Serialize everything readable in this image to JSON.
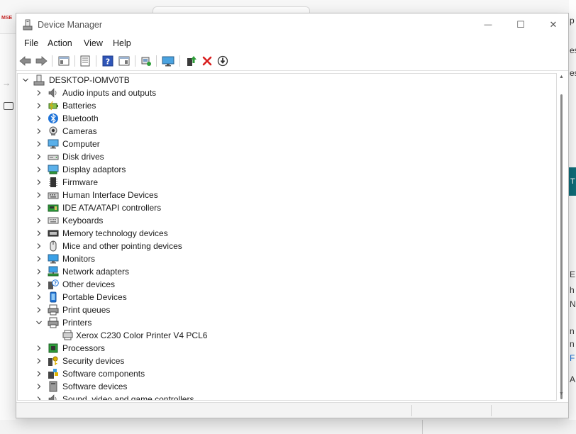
{
  "window": {
    "title": "Device Manager",
    "controls": {
      "minimize": "—",
      "maximize": "☐",
      "close": "✕"
    }
  },
  "menu": [
    "File",
    "Action",
    "View",
    "Help"
  ],
  "toolbar_icons": [
    "back-icon",
    "forward-icon",
    "show-hide-console-tree-icon",
    "properties-sheet-icon",
    "help-icon",
    "action-pane-icon",
    "scan-hardware-changes-icon",
    "monitor-icon",
    "update-driver-icon",
    "uninstall-device-icon",
    "disable-device-icon"
  ],
  "tree": {
    "root": "DESKTOP-IOMV0TB",
    "items": [
      {
        "label": "Audio inputs and outputs",
        "icon": "speaker-icon",
        "expanded": false
      },
      {
        "label": "Batteries",
        "icon": "battery-icon",
        "expanded": false
      },
      {
        "label": "Bluetooth",
        "icon": "bluetooth-icon",
        "expanded": false
      },
      {
        "label": "Cameras",
        "icon": "camera-icon",
        "expanded": false
      },
      {
        "label": "Computer",
        "icon": "computer-icon",
        "expanded": false
      },
      {
        "label": "Disk drives",
        "icon": "disk-drive-icon",
        "expanded": false
      },
      {
        "label": "Display adaptors",
        "icon": "display-adapter-icon",
        "expanded": false
      },
      {
        "label": "Firmware",
        "icon": "firmware-icon",
        "expanded": false
      },
      {
        "label": "Human Interface Devices",
        "icon": "hid-icon",
        "expanded": false
      },
      {
        "label": "IDE ATA/ATAPI controllers",
        "icon": "ide-controller-icon",
        "expanded": false
      },
      {
        "label": "Keyboards",
        "icon": "keyboard-icon",
        "expanded": false
      },
      {
        "label": "Memory technology devices",
        "icon": "memory-icon",
        "expanded": false
      },
      {
        "label": "Mice and other pointing devices",
        "icon": "mouse-icon",
        "expanded": false
      },
      {
        "label": "Monitors",
        "icon": "monitor-icon",
        "expanded": false
      },
      {
        "label": "Network adapters",
        "icon": "network-icon",
        "expanded": false
      },
      {
        "label": "Other devices",
        "icon": "unknown-device-icon",
        "expanded": false
      },
      {
        "label": "Portable Devices",
        "icon": "portable-device-icon",
        "expanded": false
      },
      {
        "label": "Print queues",
        "icon": "printer-icon",
        "expanded": false
      },
      {
        "label": "Printers",
        "icon": "printer-icon",
        "expanded": true,
        "children": [
          "Xerox C230 Color Printer V4 PCL6"
        ]
      },
      {
        "label": "Processors",
        "icon": "processor-icon",
        "expanded": false
      },
      {
        "label": "Security devices",
        "icon": "security-key-icon",
        "expanded": false
      },
      {
        "label": "Software components",
        "icon": "software-component-icon",
        "expanded": false
      },
      {
        "label": "Software devices",
        "icon": "software-device-icon",
        "expanded": false
      },
      {
        "label": "Sound, video and game controllers",
        "icon": "speaker-icon",
        "expanded": false
      }
    ]
  },
  "background": {
    "app_label": "MSE",
    "right_edge_chars": [
      "p",
      "es",
      "es",
      "T",
      "E",
      "h",
      "N",
      "n",
      "n",
      "F",
      "A"
    ]
  },
  "colors": {
    "accent_blue": "#1e73d8",
    "uninstall_red": "#d81e1e",
    "update_green": "#2e9e3a",
    "teal": "#0f6e7a"
  }
}
